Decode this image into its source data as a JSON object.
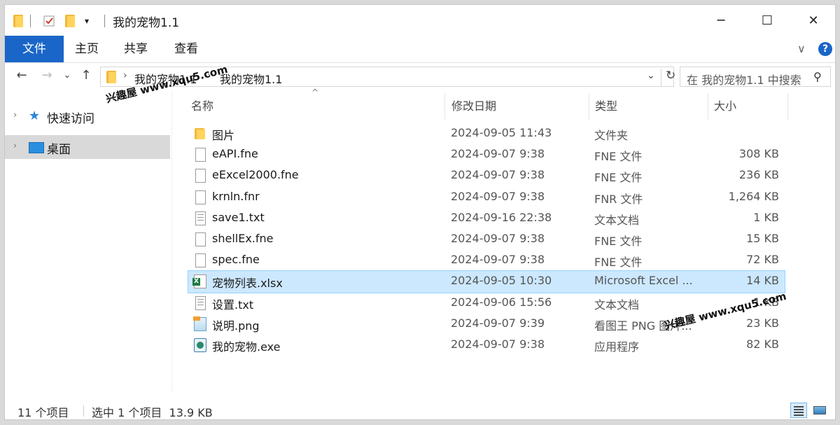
{
  "window": {
    "title": "我的宠物1.1"
  },
  "titlebar": {
    "minimize_icon": "minimize-icon",
    "maximize_icon": "maximize-icon",
    "close_icon": "close-icon",
    "minimize_glyph": "─",
    "maximize_glyph": "☐",
    "close_glyph": "✕"
  },
  "ribbon": {
    "tabs": [
      "文件",
      "主页",
      "共享",
      "查看"
    ],
    "expand_glyph": "∨",
    "help_glyph": "?"
  },
  "nav_buttons": {
    "back": "←",
    "forward": "→",
    "recent": "⌄",
    "up": "↑"
  },
  "address": {
    "crumbs": [
      "我的宠物1.1",
      "我的宠物1.1"
    ],
    "sep": "›",
    "dropdown": "⌄",
    "refresh": "↻"
  },
  "search": {
    "placeholder": "在 我的宠物1.1 中搜索",
    "icon_glyph": "⚲"
  },
  "nav_pane": {
    "items": [
      {
        "label": "快速访问",
        "icon": "star-icon"
      },
      {
        "label": "桌面",
        "icon": "desktop-icon"
      }
    ],
    "chevron": "›"
  },
  "columns": {
    "name": "名称",
    "date": "修改日期",
    "type": "类型",
    "size": "大小",
    "sort_glyph": "^"
  },
  "files": [
    {
      "name": "图片",
      "date": "2024-09-05 11:43",
      "type": "文件夹",
      "size": "",
      "icon": "folder-icon"
    },
    {
      "name": "eAPI.fne",
      "date": "2024-09-07 9:38",
      "type": "FNE 文件",
      "size": "308 KB",
      "icon": "file-icon"
    },
    {
      "name": "eExcel2000.fne",
      "date": "2024-09-07 9:38",
      "type": "FNE 文件",
      "size": "236 KB",
      "icon": "file-icon"
    },
    {
      "name": "krnln.fnr",
      "date": "2024-09-07 9:38",
      "type": "FNR 文件",
      "size": "1,264 KB",
      "icon": "file-icon"
    },
    {
      "name": "save1.txt",
      "date": "2024-09-16 22:38",
      "type": "文本文档",
      "size": "1 KB",
      "icon": "text-file-icon"
    },
    {
      "name": "shellEx.fne",
      "date": "2024-09-07 9:38",
      "type": "FNE 文件",
      "size": "15 KB",
      "icon": "file-icon"
    },
    {
      "name": "spec.fne",
      "date": "2024-09-07 9:38",
      "type": "FNE 文件",
      "size": "72 KB",
      "icon": "file-icon"
    },
    {
      "name": "宠物列表.xlsx",
      "date": "2024-09-05 10:30",
      "type": "Microsoft Excel ...",
      "size": "14 KB",
      "icon": "excel-file-icon",
      "selected": true
    },
    {
      "name": "设置.txt",
      "date": "2024-09-06 15:56",
      "type": "文本文档",
      "size": "1 KB",
      "icon": "text-file-icon"
    },
    {
      "name": "说明.png",
      "date": "2024-09-07 9:39",
      "type": "看图王 PNG 图片...",
      "size": "23 KB",
      "icon": "image-file-icon"
    },
    {
      "name": "我的宠物.exe",
      "date": "2024-09-07 9:38",
      "type": "应用程序",
      "size": "82 KB",
      "icon": "exe-file-icon"
    }
  ],
  "status": {
    "count": "11 个项目",
    "selection": "选中 1 个项目  13.9 KB"
  },
  "watermarks": [
    "兴趣屋 www.xqu5.com",
    "兴趣屋 www.xqu5.com"
  ],
  "colors": {
    "accent": "#1a66c8",
    "selection_bg": "#cce8ff",
    "folder": "#ffd35c"
  }
}
